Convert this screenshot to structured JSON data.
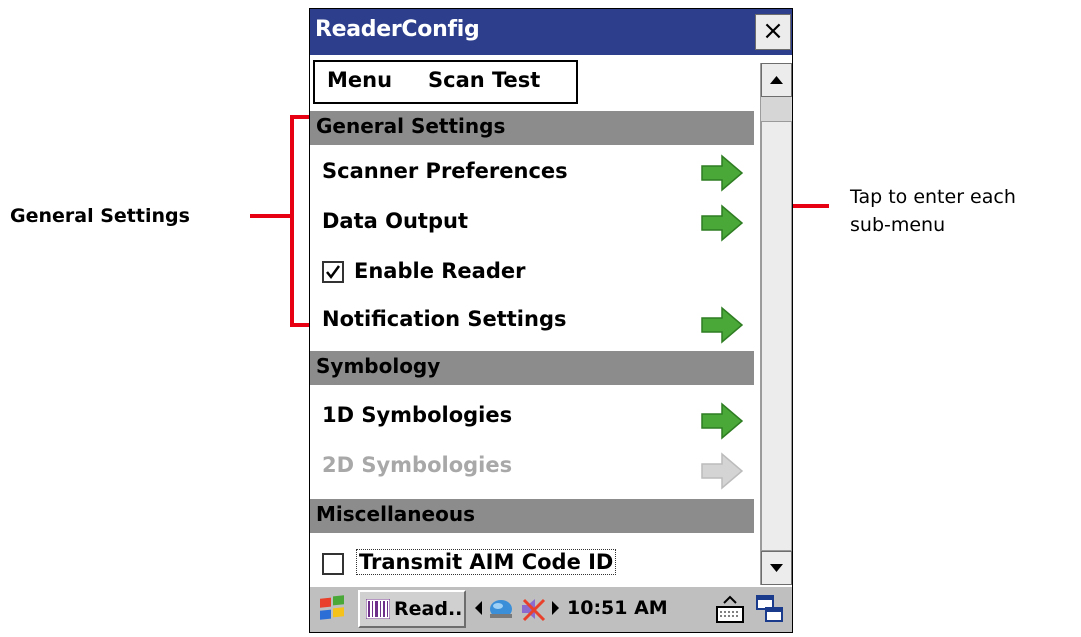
{
  "window": {
    "title": "ReaderConfig",
    "close_glyph": "×"
  },
  "menubar": {
    "menu_label": "Menu",
    "scan_test_label": "Scan Test"
  },
  "sections": {
    "general": "General Settings",
    "symbology": "Symbology",
    "misc": "Miscellaneous"
  },
  "items": {
    "scanner_preferences": "Scanner Preferences",
    "data_output": "Data Output",
    "enable_reader": {
      "label": "Enable Reader",
      "checked": true
    },
    "notification_settings": "Notification Settings",
    "symbologies_1d": "1D Symbologies",
    "symbologies_2d": "2D Symbologies",
    "transmit_aim": {
      "label": "Transmit AIM Code ID",
      "checked": false
    }
  },
  "taskbar": {
    "app_label": "Read..",
    "time": "10:51 AM"
  },
  "annotations": {
    "left_label": "General Settings",
    "right_label_line1": "Tap to enter each",
    "right_label_line2": "sub-menu"
  },
  "colors": {
    "titlebar": "#2d3f8c",
    "section_header": "#8c8c8c",
    "arrow_green": "#4aa838",
    "arrow_disabled": "#c8c8c8",
    "annotation_red": "#e60012"
  },
  "icons": {
    "close": "close-icon",
    "arrow": "right-arrow-icon",
    "check": "checkmark-icon",
    "start": "windows-start-icon",
    "app": "reader-app-icon",
    "network": "network-icon",
    "volume": "volume-icon",
    "keyboard": "keyboard-icon",
    "desktop": "desktop-icon"
  }
}
